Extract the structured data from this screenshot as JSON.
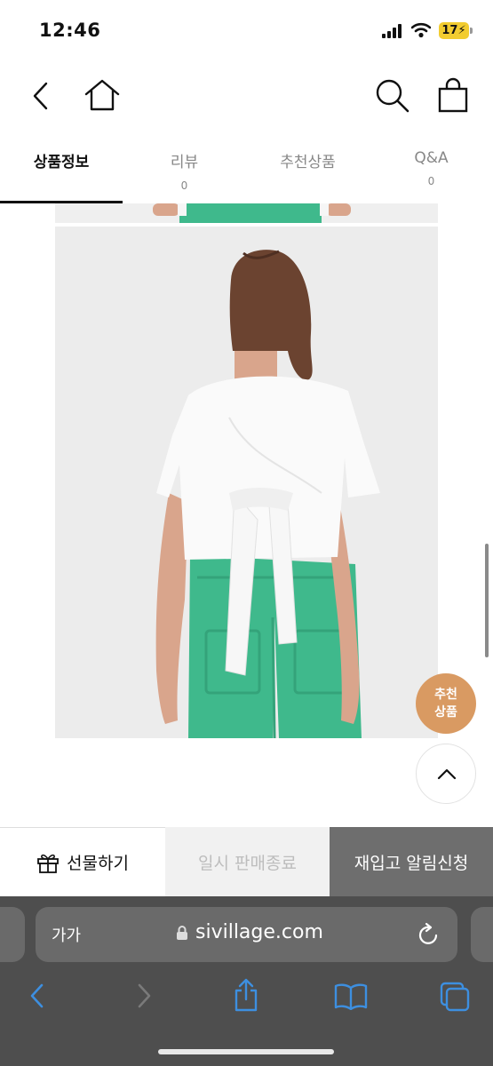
{
  "status_bar": {
    "time": "12:46",
    "battery": "17"
  },
  "header": {
    "icons": [
      "back-icon",
      "home-icon",
      "search-icon",
      "shopping-bag-icon"
    ]
  },
  "tabs": [
    {
      "label": "상품정보",
      "count": "",
      "active": true
    },
    {
      "label": "리뷰",
      "count": "0",
      "active": false
    },
    {
      "label": "추천상품",
      "count": "",
      "active": false
    },
    {
      "label": "Q&A",
      "count": "0",
      "active": false
    }
  ],
  "floating": {
    "recommend_line1": "추천",
    "recommend_line2": "상품"
  },
  "actions": {
    "gift": "선물하기",
    "sold_out": "일시 판매종료",
    "restock": "재입고 알림신청"
  },
  "safari": {
    "aa": "가가",
    "url": "sivillage.com"
  },
  "colors": {
    "accent": "#d99a62",
    "restock_bg": "#6e6e6e",
    "jeans": "#3fb98c",
    "safari_bg": "#4e4e4e",
    "safari_tint": "#3d8fe0"
  }
}
